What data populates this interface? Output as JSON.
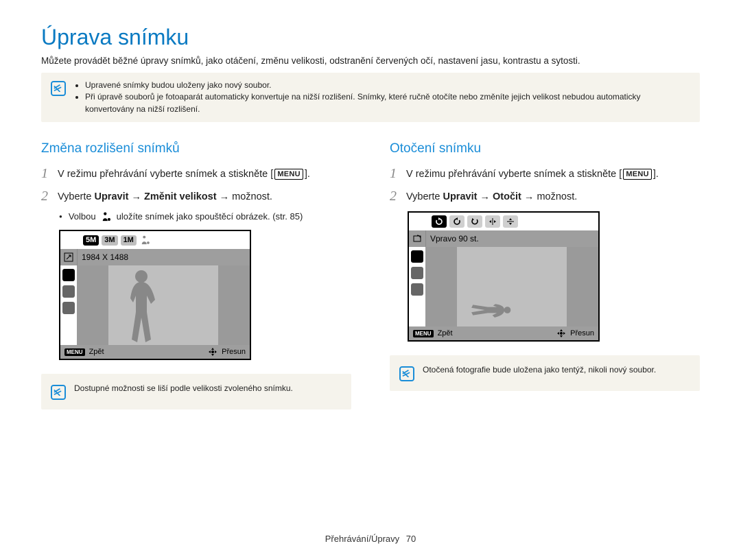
{
  "title": "Úprava snímku",
  "intro": "Můžete provádět běžné úpravy snímků, jako otáčení, změnu velikosti, odstranění červených očí, nastavení jasu, kontrastu a sytosti.",
  "top_notes": [
    "Upravené snímky budou uloženy jako nový soubor.",
    "Při úpravě souborů je fotoaparát automaticky konvertuje na nižší rozlišení. Snímky, které ručně otočíte nebo změníte jejich velikost nebudou automaticky konvertovány na nižší rozlišení."
  ],
  "left": {
    "heading": "Změna rozlišení snímků",
    "step1_pre": "V režimu přehrávání vyberte snímek a stiskněte [",
    "step1_key": "MENU",
    "step1_post": "].",
    "step2_pre": "Vyberte ",
    "step2_b1": "Upravit",
    "step2_arrow": " → ",
    "step2_b2": "Změnit velikost",
    "step2_post": " → možnost.",
    "bullet_pre": "Volbou",
    "bullet_post": " uložíte snímek jako spouštěcí obrázek. (str. 85)",
    "screen": {
      "mp_badges": [
        "5M",
        "3M",
        "1M"
      ],
      "info": "1984 X 1488",
      "back_label": "Zpět",
      "move_label": "Přesun",
      "menu_label": "MENU"
    },
    "note": "Dostupné možnosti se liší podle velikosti zvoleného snímku."
  },
  "right": {
    "heading": "Otočení snímku",
    "step1_pre": "V režimu přehrávání vyberte snímek a stiskněte [",
    "step1_key": "MENU",
    "step1_post": "].",
    "step2_pre": "Vyberte ",
    "step2_b1": "Upravit",
    "step2_arrow": " → ",
    "step2_b2": "Otočit",
    "step2_post": " → možnost.",
    "screen": {
      "info": "Vpravo 90 st.",
      "back_label": "Zpět",
      "move_label": "Přesun",
      "menu_label": "MENU"
    },
    "note": "Otočená fotografie bude uložena jako tentýž, nikoli nový soubor."
  },
  "footer": {
    "section": "Přehrávání/Úpravy",
    "page": "70"
  }
}
